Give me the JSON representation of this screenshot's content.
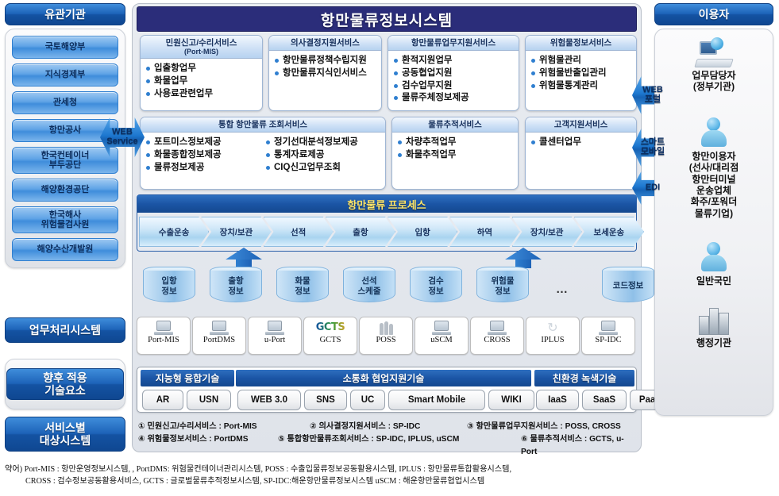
{
  "left": {
    "org_title": "유관기관",
    "orgs": [
      "국토해양부",
      "지식경제부",
      "관세청",
      "항만공사",
      "한국컨테이너\n부두공단",
      "해양환경공단",
      "한국해사\n위험물검사원",
      "해양수산개발원"
    ],
    "label_business": "업무처리시스템",
    "label_future": "향후 적용\n기술요소",
    "label_service": "서비스별\n대상시스템"
  },
  "center": {
    "system_title": "항만물류정보시스템",
    "services_row1": [
      {
        "title": "민원신고/수리서비스",
        "subtitle": "(Port-MIS)",
        "items": [
          "입출항업무",
          "화물업무",
          "사용료관련업무"
        ]
      },
      {
        "title": "의사결정지원서비스",
        "subtitle": "",
        "items": [
          "항만물류정책수립지원",
          "항만물류지식인서비스"
        ]
      },
      {
        "title": "항만물류업무지원서비스",
        "subtitle": "",
        "items": [
          "환적지원업무",
          "공동협업지원",
          "검수업무지원",
          "물류주체정보제공"
        ]
      },
      {
        "title": "위험물정보서비스",
        "subtitle": "",
        "items": [
          "위험물관리",
          "위험물반출입관리",
          "위험물통계관리"
        ]
      }
    ],
    "services_row2": [
      {
        "title": "통합 항만물류 조회서비스",
        "subtitle": "",
        "items_left": [
          "포트미스정보제공",
          "화물종합정보제공",
          "물류정보제공"
        ],
        "items_right": [
          "정기선대분석정보제공",
          "통계자료제공",
          "CIQ신고업무조회"
        ]
      },
      {
        "title": "물류추적서비스",
        "subtitle": "",
        "items": [
          "차량추적업무",
          "화물추적업무"
        ]
      },
      {
        "title": "고객지원서비스",
        "subtitle": "",
        "items": [
          "콜센터업무"
        ]
      }
    ],
    "process_title": "항만물류 프로세스",
    "process_steps": [
      "수출운송",
      "장치/보관",
      "선적",
      "출항",
      "입항",
      "하역",
      "장치/보관",
      "보세운송"
    ],
    "databases": [
      "입항\n정보",
      "출항\n정보",
      "화물\n정보",
      "선석\n스케줄",
      "검수\n정보",
      "위험물\n정보",
      "코드정보"
    ],
    "db_ellipsis": "…",
    "systems": [
      {
        "label": "Port-MIS",
        "icon": "laptop-icon"
      },
      {
        "label": "PortDMS",
        "icon": "laptop-icon"
      },
      {
        "label": "u-Port",
        "icon": "laptop-icon"
      },
      {
        "label": "GCTS",
        "icon": "gcts-logo-icon"
      },
      {
        "label": "POSS",
        "icon": "people-icon"
      },
      {
        "label": "uSCM",
        "icon": "laptop-icon"
      },
      {
        "label": "CROSS",
        "icon": "laptop-icon"
      },
      {
        "label": "IPLUS",
        "icon": "recycle-icon"
      },
      {
        "label": "SP-IDC",
        "icon": "laptop-icon"
      }
    ],
    "tech_groups": [
      {
        "title": "지능형 융합기술",
        "chips": [
          "AR",
          "USN"
        ]
      },
      {
        "title": "소통화 협업지원기술",
        "chips": [
          "WEB 3.0",
          "SNS",
          "UC",
          "Smart Mobile",
          "WIKI"
        ]
      },
      {
        "title": "친환경 녹색기술",
        "chips": [
          "IaaS",
          "SaaS",
          "PaaS"
        ]
      }
    ],
    "legend": {
      "r1c1": "① 민원신고/수리서비스 : Port-MIS",
      "r1c2": "② 의사결정지원서비스 : SP-IDC",
      "r1c3": "③ 항만물류업무지원서비스 : POSS, CROSS",
      "r2c1": "④ 위험물정보서비스 : PortDMS",
      "r2c2": "⑤ 통합항만물류조회서비스 : SP-IDC, IPLUS, uSCM",
      "r2c3": "⑥ 물류추적서비스 : GCTS, u-Port"
    }
  },
  "connectors": {
    "web_service": "WEB\nService",
    "web_portal": "WEB\n포털",
    "smart_mobile": "스마트\n모바일",
    "edi": "EDI"
  },
  "right": {
    "title": "이용자",
    "users": [
      {
        "icon": "desk-worker-icon",
        "label": "업무담당자\n(정부기관)"
      },
      {
        "icon": "person-icon",
        "label": "항만이용자\n(선사/대리점\n항만터미널\n운송업체\n화주/포워더\n물류기업)"
      },
      {
        "icon": "person-icon",
        "label": "일반국민"
      },
      {
        "icon": "building-icon",
        "label": "행정기관"
      }
    ]
  },
  "footer": {
    "line1": "약어) Port-MIS : 항만운영정보시스템, , PortDMS: 위험물컨테이너관리시스템, POSS : 수출입물류정보공동활용시스템, IPLUS : 항만물류통합활용시스템,",
    "line2": "CROSS : 검수정보공동활용서비스, GCTS : 글로벌물류추적정보시스템, SP-IDC:해운항만물류정보시스템 uSCM : 해운항만물류협업시스템"
  },
  "colors": {
    "header_navy": "#2b2d7a",
    "cap_blue": "#1453a3",
    "accent_blue": "#2f7fd0",
    "process_title_text": "#ffe76a"
  }
}
